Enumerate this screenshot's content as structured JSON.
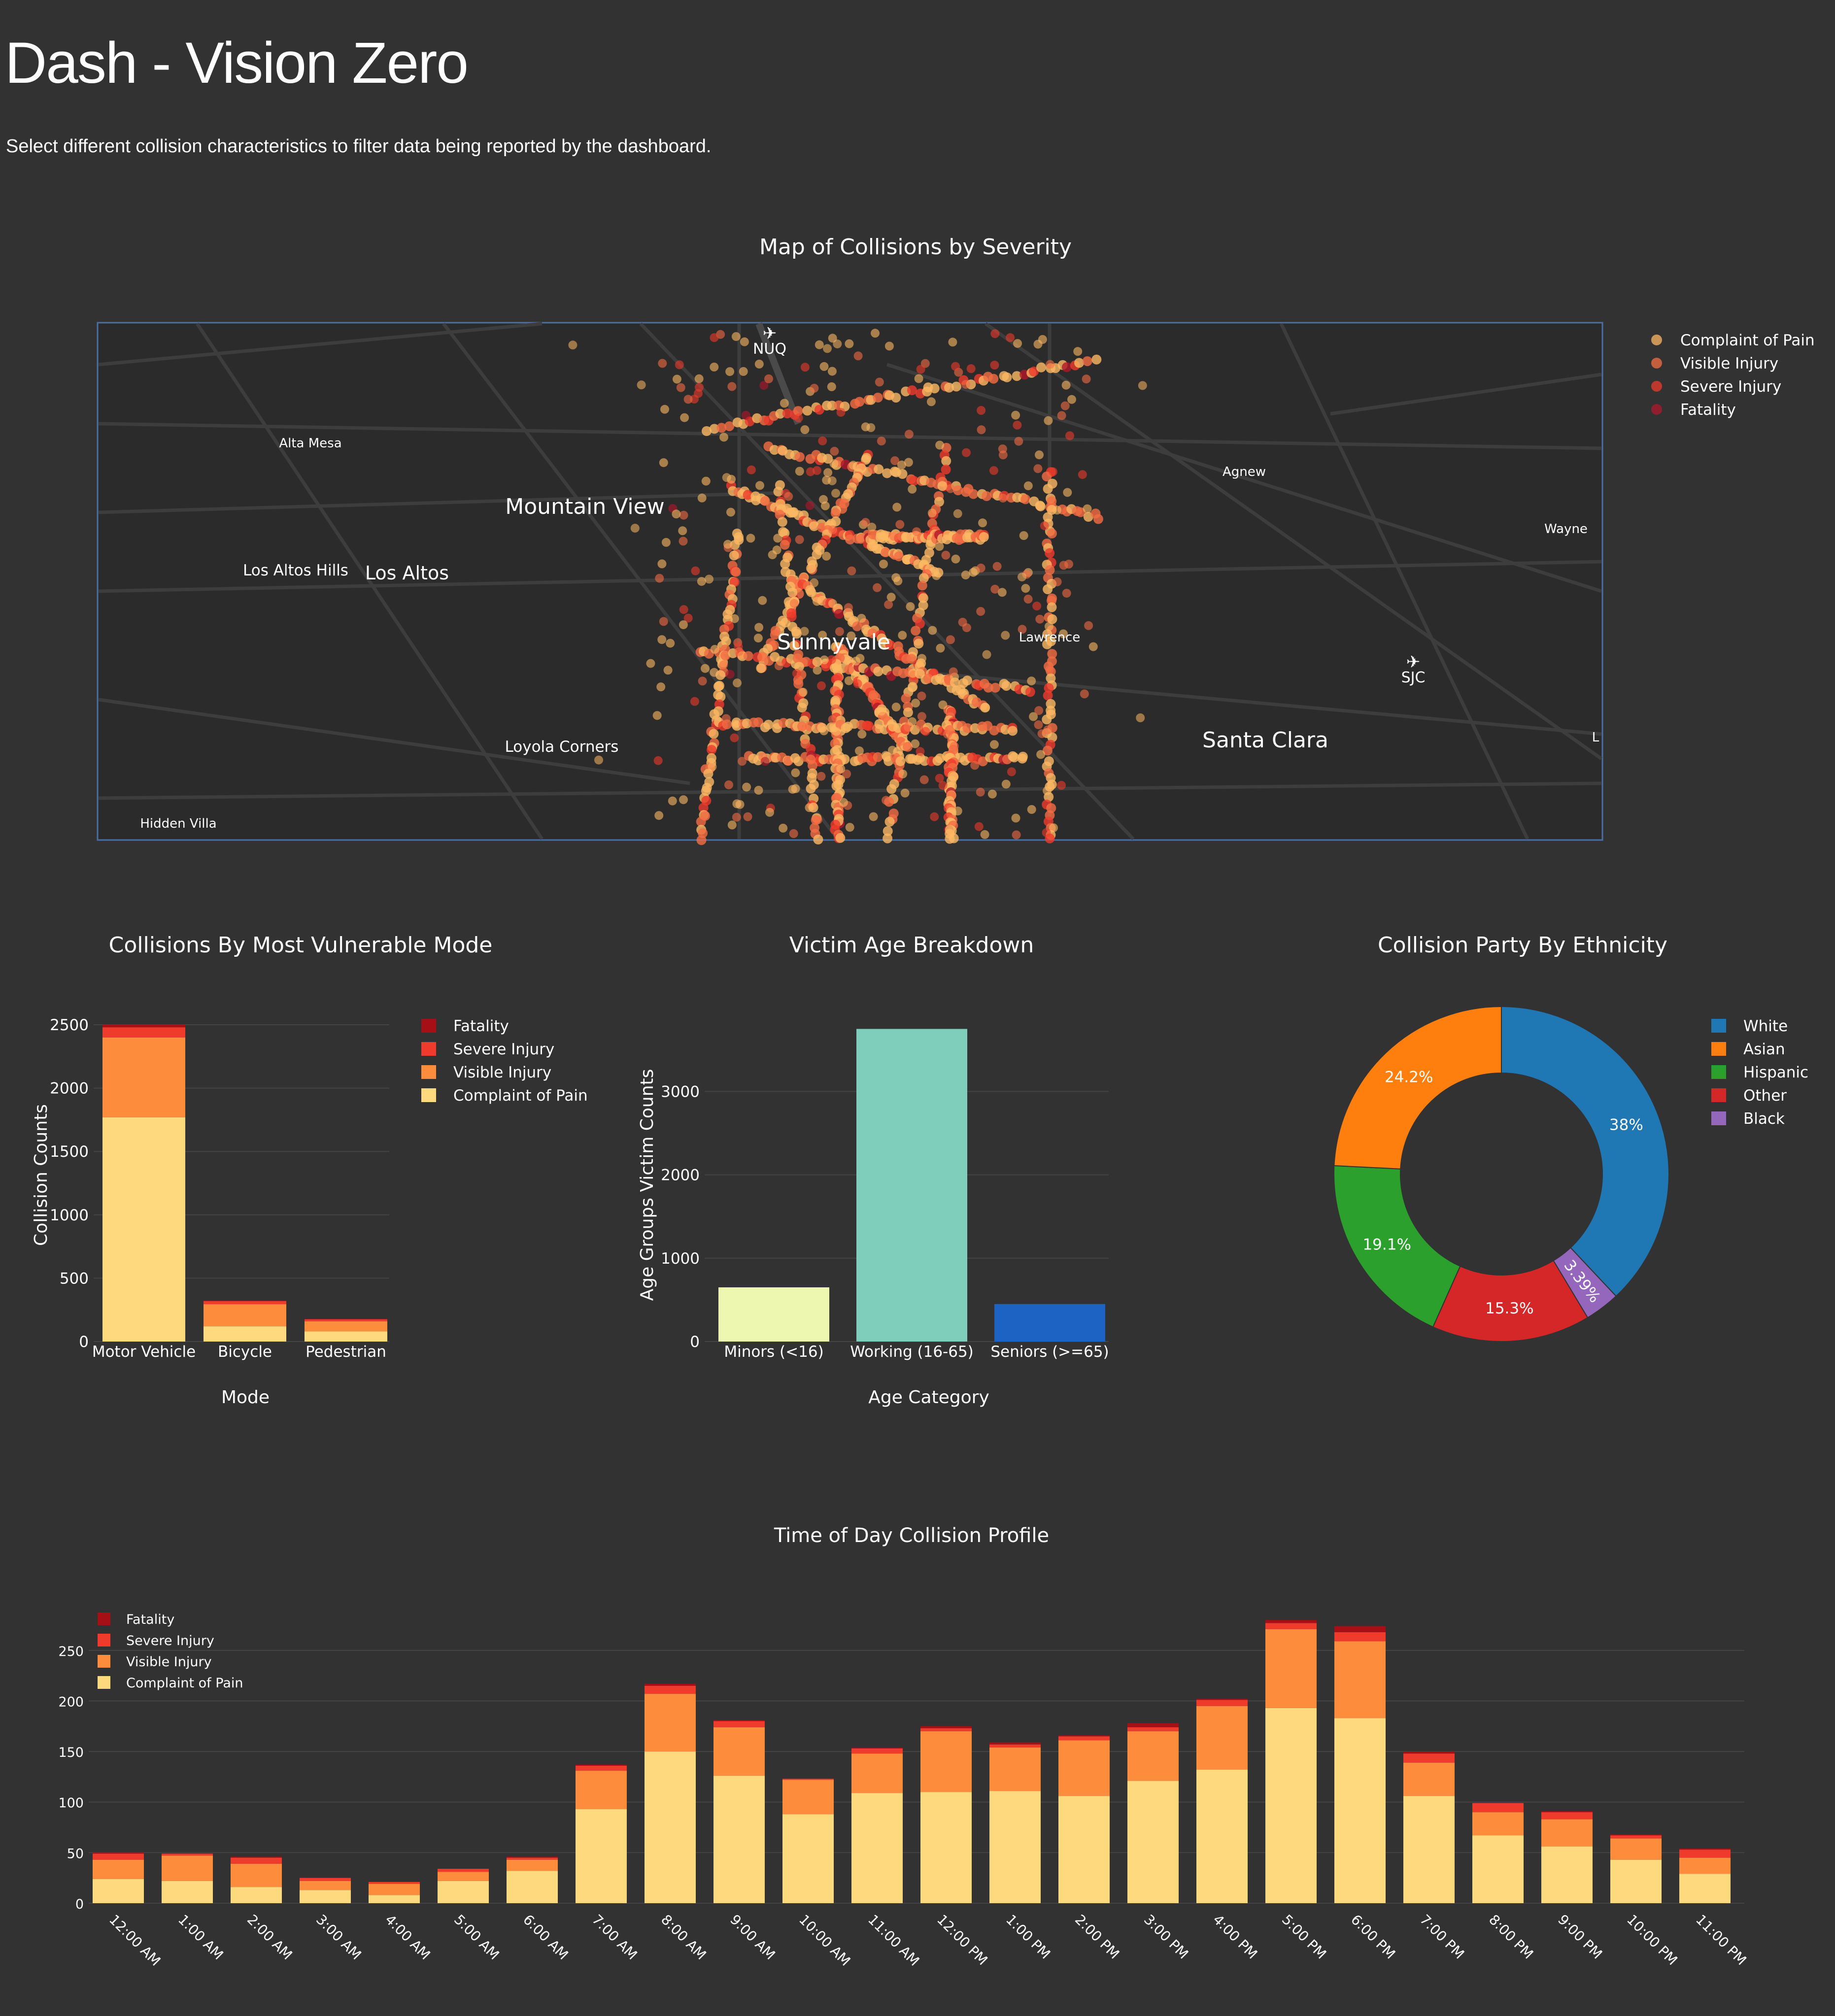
{
  "header": {
    "title": "Dash - Vision Zero",
    "description": "Select different collision characteristics to filter data being reported by the dashboard."
  },
  "colors": {
    "background": "#323232",
    "fatality": "#a50f15",
    "severe_injury": "#ef3b2c",
    "visible_injury": "#fd8d3c",
    "complaint_of_pain": "#ffd97d",
    "map_fatality": "#b2182b",
    "map_severe": "#ef3b2c",
    "map_visible": "#f46d43",
    "map_complaint": "#fdb863",
    "white": "#1f77b4",
    "asian": "#ff7f0e",
    "hispanic": "#2ca02c",
    "other": "#d62728",
    "black": "#9467bd",
    "minors": "#eef7b0",
    "working": "#7fcdbb",
    "seniors": "#1c63c4"
  },
  "map": {
    "title": "Map of Collisions by Severity",
    "legend": [
      "Complaint of Pain",
      "Visible Injury",
      "Severe Injury",
      "Fatality"
    ],
    "places": [
      {
        "name": "NUQ",
        "kind": "airport"
      },
      {
        "name": "Alta Mesa",
        "kind": "small"
      },
      {
        "name": "Mountain View",
        "kind": "city"
      },
      {
        "name": "Agnew",
        "kind": "small"
      },
      {
        "name": "Wayne",
        "kind": "small"
      },
      {
        "name": "Los Altos Hills",
        "kind": "medium"
      },
      {
        "name": "Los Altos",
        "kind": "city-medium"
      },
      {
        "name": "Sunnyvale",
        "kind": "city"
      },
      {
        "name": "Lawrence",
        "kind": "small"
      },
      {
        "name": "SJC",
        "kind": "airport"
      },
      {
        "name": "Loyola Corners",
        "kind": "medium"
      },
      {
        "name": "Santa Clara",
        "kind": "city"
      },
      {
        "name": "L",
        "kind": "small"
      },
      {
        "name": "Hidden Villa",
        "kind": "small"
      }
    ]
  },
  "chart_data": [
    {
      "type": "bar",
      "stacked": true,
      "title": "Collisions By Most Vulnerable Mode",
      "xlabel": "Mode",
      "ylabel": "Collision Counts",
      "ylim": [
        0,
        2500
      ],
      "yticks": [
        0,
        500,
        1000,
        1500,
        2000,
        2500
      ],
      "categories": [
        "Motor Vehicle",
        "Bicycle",
        "Pedestrian"
      ],
      "legend_placement": "right",
      "series": [
        {
          "name": "Complaint of Pain",
          "values": [
            1770,
            120,
            80
          ]
        },
        {
          "name": "Visible Injury",
          "values": [
            630,
            175,
            80
          ]
        },
        {
          "name": "Severe Injury",
          "values": [
            80,
            25,
            15
          ]
        },
        {
          "name": "Fatality",
          "values": [
            20,
            3,
            5
          ]
        }
      ]
    },
    {
      "type": "bar",
      "title": "Victim Age Breakdown",
      "xlabel": "Age Category",
      "ylabel": "Age Groups Victim Counts",
      "ylim": [
        0,
        3800
      ],
      "yticks": [
        0,
        1000,
        2000,
        3000
      ],
      "categories": [
        "Minors (<16)",
        "Working (16-65)",
        "Seniors (>=65)"
      ],
      "values": [
        650,
        3750,
        450
      ]
    },
    {
      "type": "pie",
      "hole": true,
      "title": "Collision Party By Ethnicity",
      "labels": [
        "White",
        "Asian",
        "Hispanic",
        "Other",
        "Black"
      ],
      "values": [
        38,
        24.2,
        19.1,
        15.3,
        3.39
      ],
      "display_labels": [
        "38%",
        "24.2%",
        "19.1%",
        "15.3%",
        "3.39%"
      ],
      "legend_placement": "right"
    },
    {
      "type": "bar",
      "stacked": true,
      "title": "Time of Day Collision Profile",
      "ylim": [
        0,
        285
      ],
      "yticks": [
        0,
        50,
        100,
        150,
        200,
        250
      ],
      "legend_placement": "top-left",
      "categories": [
        "12:00 AM",
        "1:00 AM",
        "2:00 AM",
        "3:00 AM",
        "4:00 AM",
        "5:00 AM",
        "6:00 AM",
        "7:00 AM",
        "8:00 AM",
        "9:00 AM",
        "10:00 AM",
        "11:00 AM",
        "12:00 PM",
        "1:00 PM",
        "2:00 PM",
        "3:00 PM",
        "4:00 PM",
        "5:00 PM",
        "6:00 PM",
        "7:00 PM",
        "8:00 PM",
        "9:00 PM",
        "10:00 PM",
        "11:00 PM"
      ],
      "series": [
        {
          "name": "Complaint of Pain",
          "values": [
            24,
            22,
            16,
            13,
            8,
            22,
            32,
            93,
            150,
            126,
            88,
            109,
            110,
            111,
            106,
            121,
            132,
            193,
            183,
            106,
            67,
            56,
            43,
            29
          ]
        },
        {
          "name": "Visible Injury",
          "values": [
            19,
            25,
            23,
            9,
            11,
            9,
            11,
            38,
            57,
            48,
            34,
            39,
            60,
            43,
            55,
            49,
            63,
            78,
            76,
            33,
            23,
            27,
            21,
            16
          ]
        },
        {
          "name": "Severe Injury",
          "values": [
            6,
            2,
            6,
            3,
            2,
            3,
            2,
            5,
            8,
            6,
            1,
            5,
            3,
            3,
            4,
            4,
            6,
            6,
            9,
            9,
            9,
            7,
            3,
            8
          ]
        },
        {
          "name": "Fatality",
          "values": [
            1,
            0,
            1,
            0,
            0,
            0,
            1,
            1,
            2,
            1,
            0,
            1,
            2,
            2,
            1,
            4,
            1,
            3,
            6,
            2,
            0,
            1,
            1,
            1
          ]
        }
      ]
    }
  ]
}
